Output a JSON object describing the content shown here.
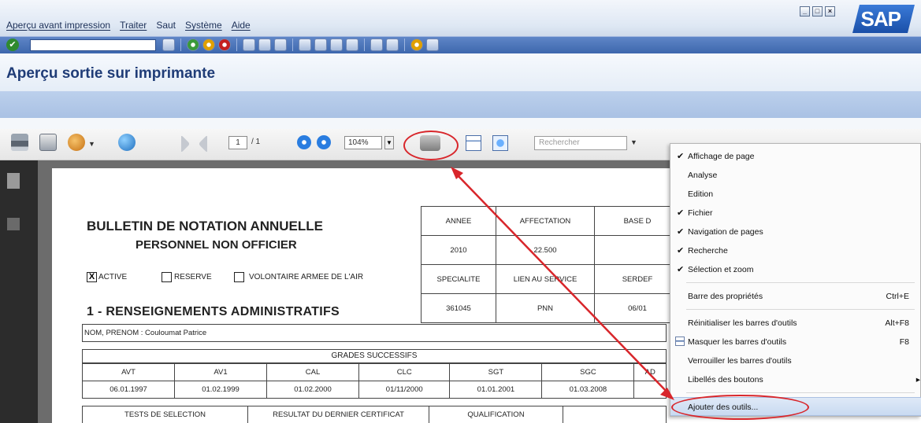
{
  "menubar": {
    "items": [
      "Aperçu avant impression",
      "Traiter",
      "Saut",
      "Système",
      "Aide"
    ],
    "logo": "SAP"
  },
  "page_title": "Aperçu sortie sur imprimante",
  "toolbar": {
    "page_current": "1",
    "page_total": "/ 1",
    "zoom": "104%",
    "search_placeholder": "Rechercher"
  },
  "document": {
    "title_line1": "BULLETIN DE NOTATION ANNUELLE",
    "title_line2": "PERSONNEL NON OFFICIER",
    "checkboxes": [
      {
        "label": "ACTIVE",
        "checked": "X"
      },
      {
        "label": "RESERVE",
        "checked": ""
      },
      {
        "label": "VOLONTAIRE ARMEE DE L'AIR",
        "checked": ""
      }
    ],
    "section1": "1 - RENSEIGNEMENTS ADMINISTRATIFS",
    "top_table": {
      "row1": [
        "ANNEE",
        "AFFECTATION",
        "BASE D"
      ],
      "row2": [
        "2010",
        "22.500",
        ""
      ],
      "row3": [
        "SPECIALITE",
        "LIEN AU SERVICE",
        "SERDEF"
      ],
      "row4": [
        "361045",
        "PNN",
        "06/01"
      ]
    },
    "nom_prenom": "NOM, PRENOM :  Couloumat Patrice",
    "grades_header": "GRADES SUCCESSIFS",
    "grades_table": {
      "headers": [
        "AVT",
        "AV1",
        "CAL",
        "CLC",
        "SGT",
        "SGC",
        "AD"
      ],
      "values": [
        "06.01.1997",
        "01.02.1999",
        "01.02.2000",
        "01/11/2000",
        "01.01.2001",
        "01.03.2008",
        ""
      ]
    },
    "bottom_headers": [
      "TESTS DE SELECTION",
      "RESULTAT DU  DERNIER CERTIFICAT",
      "QUALIFICATION"
    ]
  },
  "context_menu": {
    "group1": [
      {
        "label": "Affichage de page",
        "checked": "✔"
      },
      {
        "label": "Analyse",
        "checked": ""
      },
      {
        "label": "Edition",
        "checked": ""
      },
      {
        "label": "Fichier",
        "checked": "✔"
      },
      {
        "label": "Navigation de pages",
        "checked": "✔"
      },
      {
        "label": "Recherche",
        "checked": "✔"
      },
      {
        "label": "Sélection et zoom",
        "checked": "✔"
      }
    ],
    "props": {
      "label": "Barre des propriétés",
      "shortcut": "Ctrl+E"
    },
    "group3": [
      {
        "label": "Réinitialiser les barres d'outils",
        "shortcut": "Alt+F8"
      },
      {
        "label": "Masquer les barres d'outils",
        "shortcut": "F8"
      },
      {
        "label": "Verrouiller les barres d'outils",
        "shortcut": ""
      },
      {
        "label": "Libellés des boutons",
        "shortcut": ""
      }
    ],
    "add_tools": "Ajouter des outils..."
  },
  "colors": {
    "annotation": "#d8262b",
    "sap_blue": "#3d67ad"
  }
}
